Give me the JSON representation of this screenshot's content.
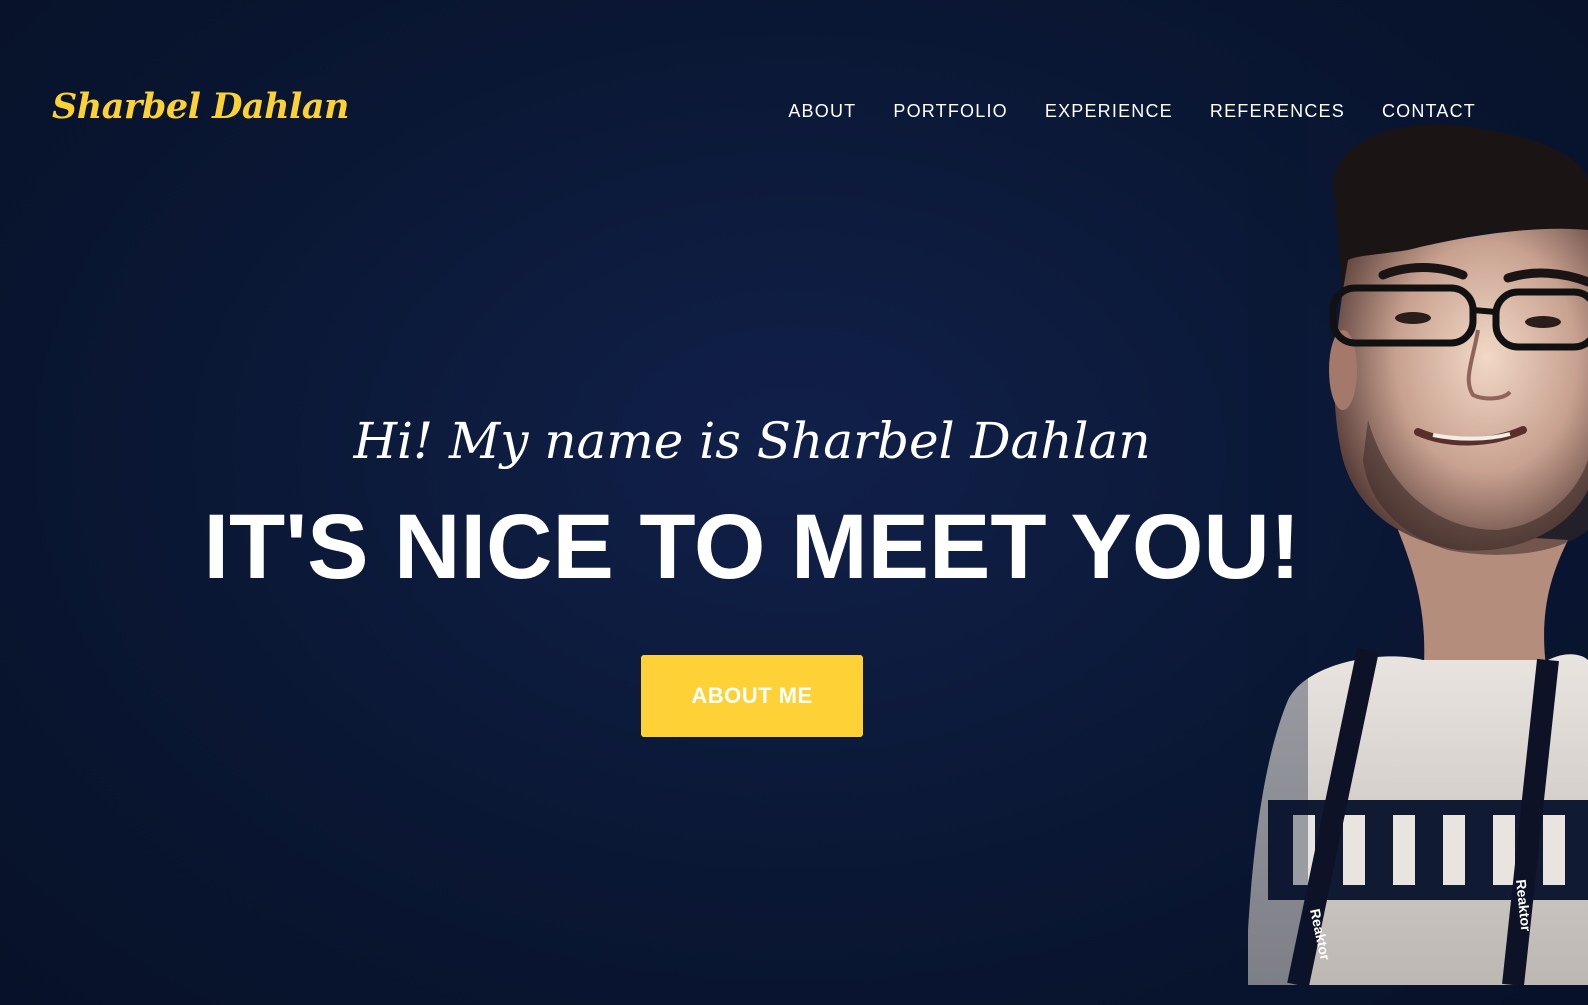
{
  "brand": {
    "name": "Sharbel Dahlan",
    "color": "#fcd135"
  },
  "nav": {
    "items": [
      {
        "label": "ABOUT"
      },
      {
        "label": "PORTFOLIO"
      },
      {
        "label": "EXPERIENCE"
      },
      {
        "label": "REFERENCES"
      },
      {
        "label": "CONTACT"
      }
    ]
  },
  "hero": {
    "greeting": "Hi! My name is Sharbel Dahlan",
    "headline": "IT'S NICE TO MEET YOU!",
    "cta_label": "ABOUT ME",
    "cta_color": "#fed136",
    "background_color": "#0b1735"
  },
  "portrait": {
    "description_icon": "person-portrait-photo",
    "badge_text": "Reaktor"
  }
}
